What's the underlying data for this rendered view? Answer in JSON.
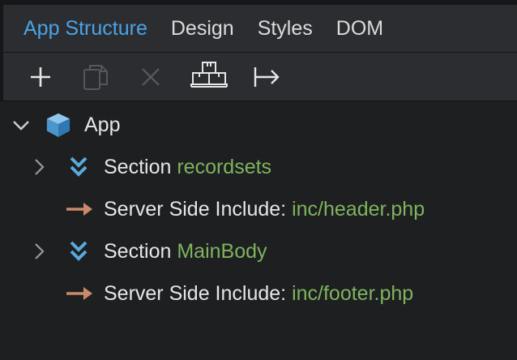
{
  "tabs": [
    {
      "label": "App Structure",
      "active": true
    },
    {
      "label": "Design",
      "active": false
    },
    {
      "label": "Styles",
      "active": false
    },
    {
      "label": "DOM",
      "active": false
    }
  ],
  "toolbar": {
    "add": {
      "icon": "plus-icon",
      "enabled": true
    },
    "duplicate": {
      "icon": "copy-icon",
      "enabled": false
    },
    "delete": {
      "icon": "close-icon",
      "enabled": false
    },
    "wrap": {
      "icon": "boxes-icon",
      "enabled": true
    },
    "move": {
      "icon": "move-into-icon",
      "enabled": true
    }
  },
  "tree": {
    "root": {
      "label": "App",
      "icon": "cube-icon",
      "expanded": true
    },
    "children": [
      {
        "type": "section",
        "label": "Section",
        "value": "recordsets",
        "icon": "double-chevron-icon",
        "expandable": true
      },
      {
        "type": "include",
        "label": "Server Side Include:",
        "value": "inc/header.php",
        "icon": "arrow-right-icon",
        "expandable": false
      },
      {
        "type": "section",
        "label": "Section",
        "value": "MainBody",
        "icon": "double-chevron-icon",
        "expandable": true
      },
      {
        "type": "include",
        "label": "Server Side Include:",
        "value": "inc/footer.php",
        "icon": "arrow-right-icon",
        "expandable": false
      }
    ]
  },
  "colors": {
    "accent": "#4aa3e8",
    "value_green": "#7fb35e",
    "include_arrow": "#c98a6a",
    "cube_blue": "#5aa8dc"
  }
}
